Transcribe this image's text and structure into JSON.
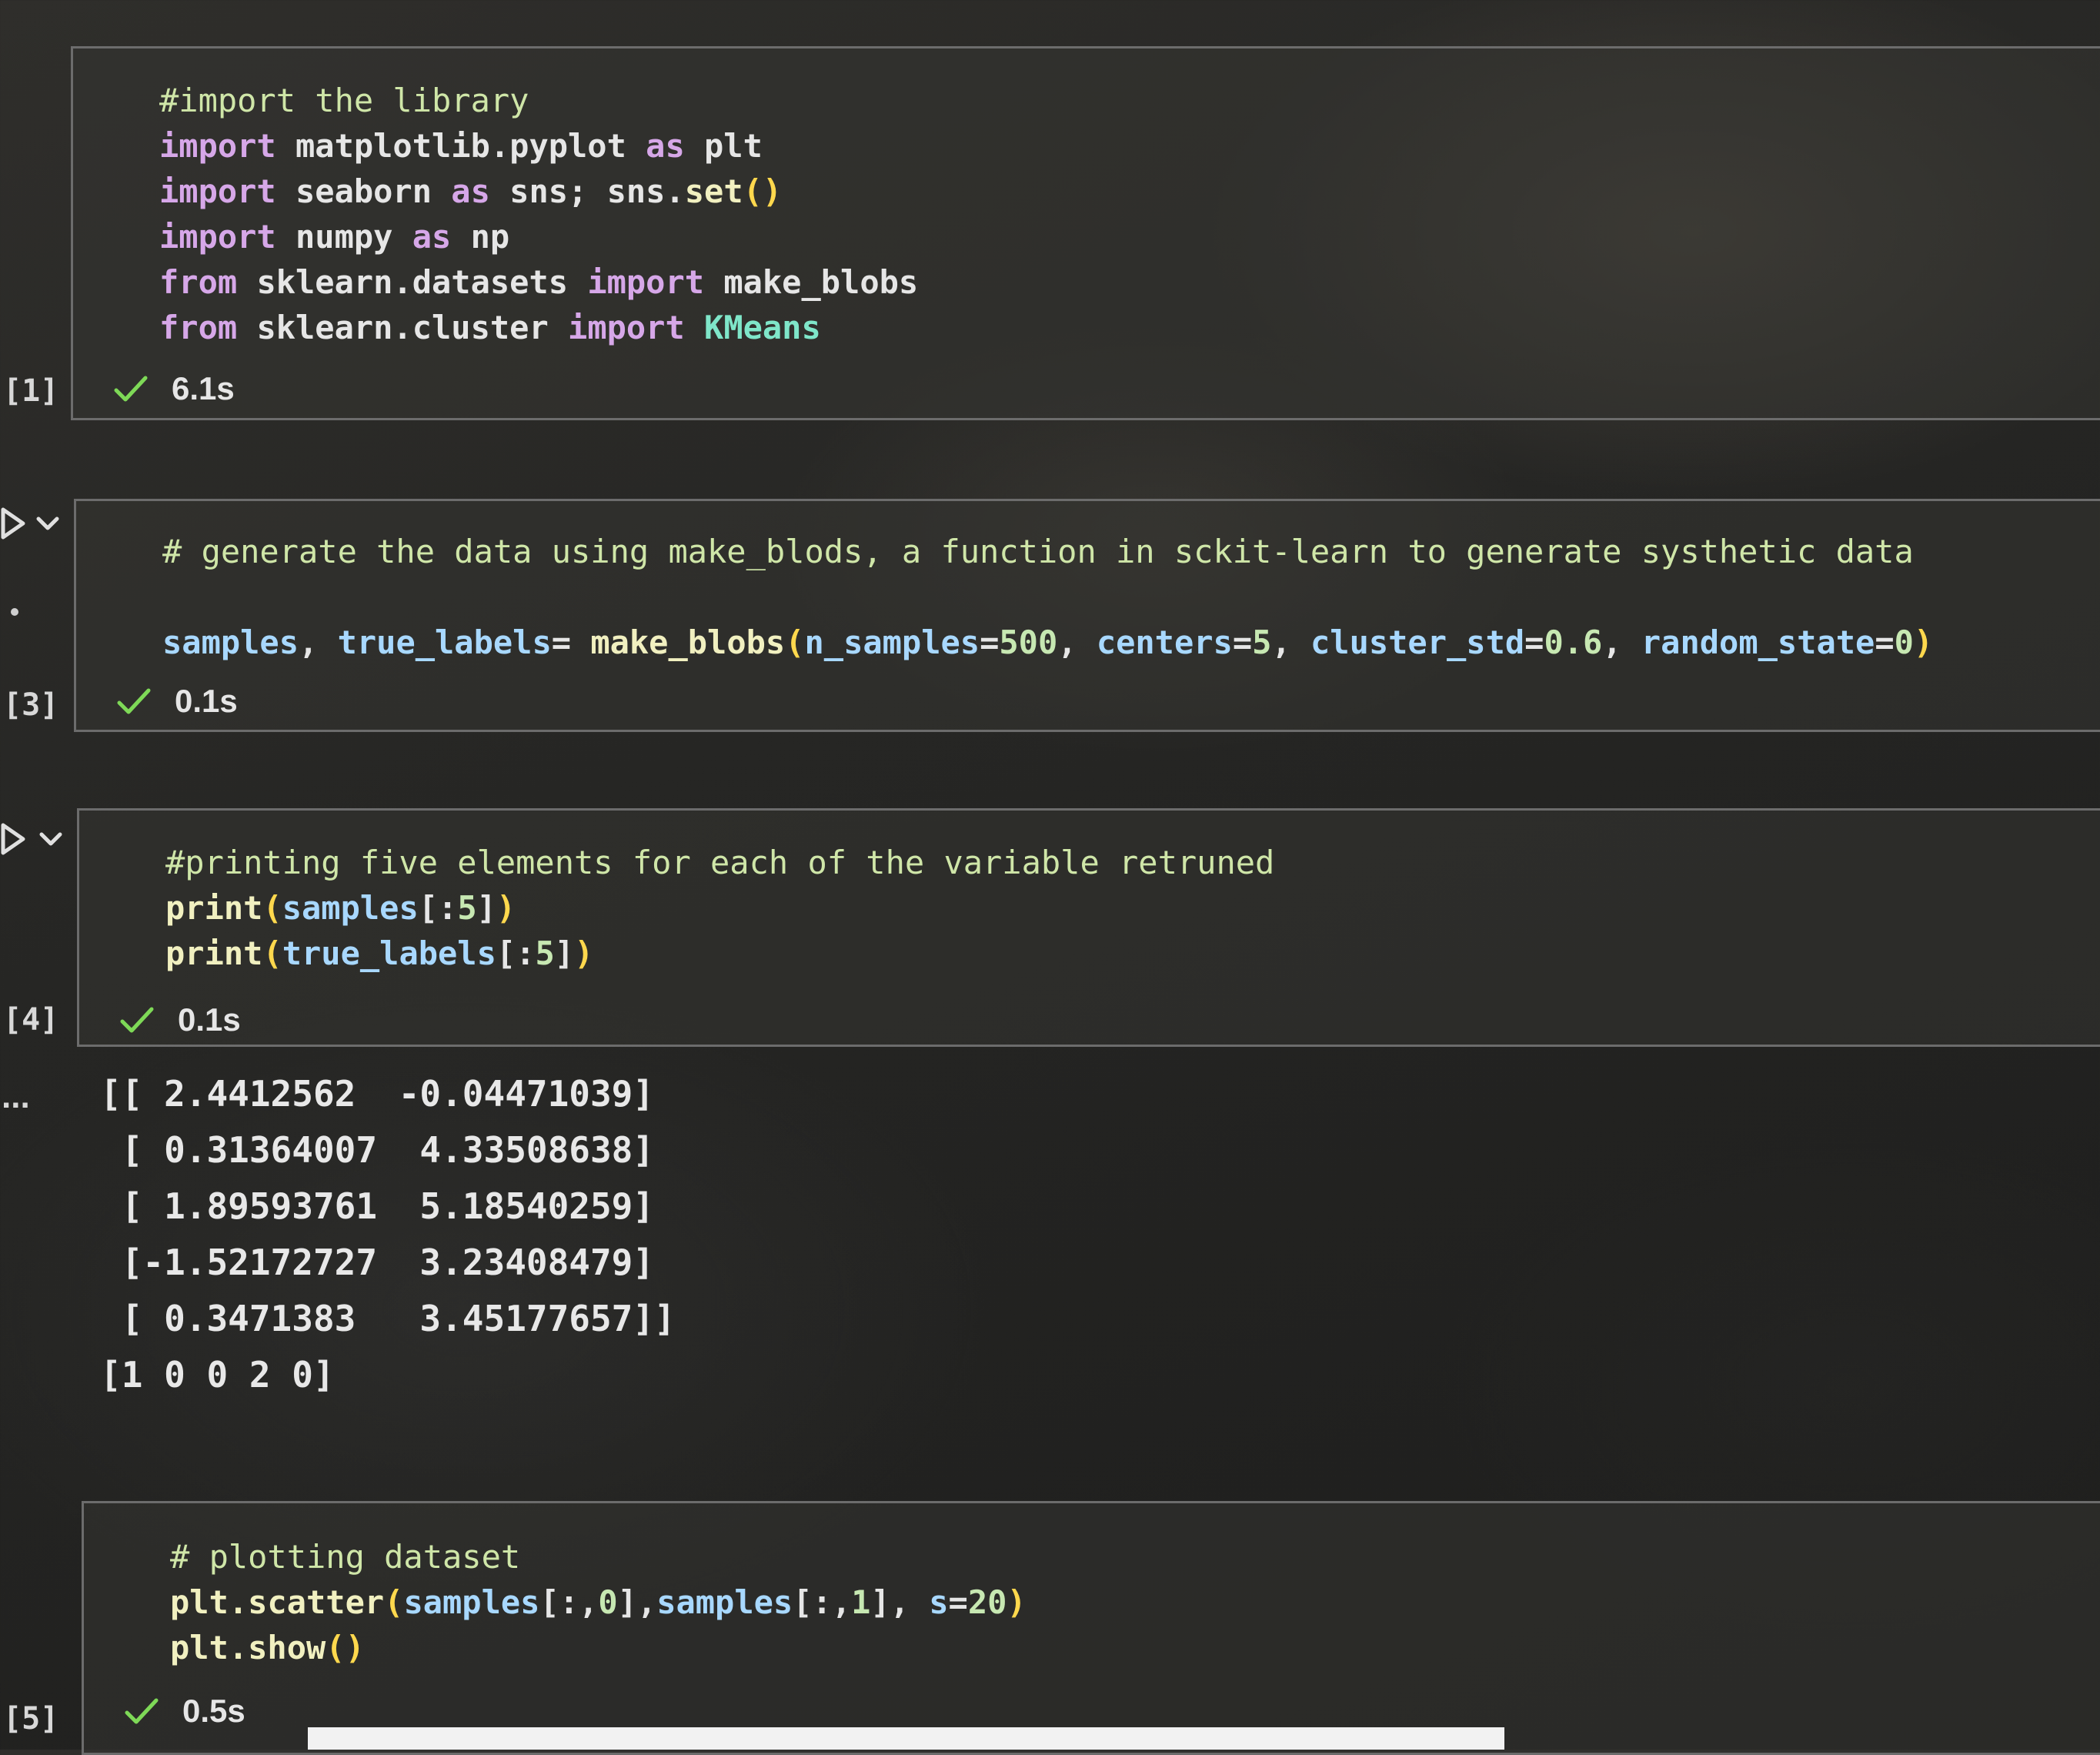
{
  "cells": [
    {
      "exec_count": "[1]",
      "time": "6.1s",
      "lines": [
        [
          {
            "t": "comment",
            "v": "#import the library"
          }
        ],
        [
          {
            "t": "keyword",
            "v": "import"
          },
          {
            "t": "plain",
            "v": " matplotlib.pyplot "
          },
          {
            "t": "keyword",
            "v": "as"
          },
          {
            "t": "plain",
            "v": " plt"
          }
        ],
        [
          {
            "t": "keyword",
            "v": "import"
          },
          {
            "t": "plain",
            "v": " seaborn "
          },
          {
            "t": "keyword",
            "v": "as"
          },
          {
            "t": "plain",
            "v": " sns; sns."
          },
          {
            "t": "fn",
            "v": "set"
          },
          {
            "t": "bracket",
            "v": "()"
          }
        ],
        [
          {
            "t": "keyword",
            "v": "import"
          },
          {
            "t": "plain",
            "v": " numpy "
          },
          {
            "t": "keyword",
            "v": "as"
          },
          {
            "t": "plain",
            "v": " np"
          }
        ],
        [
          {
            "t": "keyword",
            "v": "from"
          },
          {
            "t": "plain",
            "v": " sklearn.datasets "
          },
          {
            "t": "keyword",
            "v": "import"
          },
          {
            "t": "plain",
            "v": " make_blobs"
          }
        ],
        [
          {
            "t": "keyword",
            "v": "from"
          },
          {
            "t": "plain",
            "v": " sklearn.cluster "
          },
          {
            "t": "keyword",
            "v": "import"
          },
          {
            "t": "cls",
            "v": " KMeans"
          }
        ]
      ]
    },
    {
      "exec_count": "[3]",
      "time": "0.1s",
      "lines": [
        [
          {
            "t": "comment",
            "v": "# generate the data using make_blods, a function in sckit-learn to generate systhetic data"
          }
        ],
        [],
        [
          {
            "t": "var",
            "v": "samples"
          },
          {
            "t": "punc",
            "v": ", "
          },
          {
            "t": "var",
            "v": "true_labels"
          },
          {
            "t": "punc",
            "v": "= "
          },
          {
            "t": "fn",
            "v": "make_blobs"
          },
          {
            "t": "bracket",
            "v": "("
          },
          {
            "t": "var",
            "v": "n_samples"
          },
          {
            "t": "punc",
            "v": "="
          },
          {
            "t": "num",
            "v": "500"
          },
          {
            "t": "punc",
            "v": ", "
          },
          {
            "t": "var",
            "v": "centers"
          },
          {
            "t": "punc",
            "v": "="
          },
          {
            "t": "num",
            "v": "5"
          },
          {
            "t": "punc",
            "v": ", "
          },
          {
            "t": "var",
            "v": "cluster_std"
          },
          {
            "t": "punc",
            "v": "="
          },
          {
            "t": "num",
            "v": "0.6"
          },
          {
            "t": "punc",
            "v": ", "
          },
          {
            "t": "var",
            "v": "random_state"
          },
          {
            "t": "punc",
            "v": "="
          },
          {
            "t": "num",
            "v": "0"
          },
          {
            "t": "bracket",
            "v": ")"
          }
        ]
      ]
    },
    {
      "exec_count": "[4]",
      "time": "0.1s",
      "lines": [
        [
          {
            "t": "comment",
            "v": "#printing five elements for each of the variable retruned"
          }
        ],
        [
          {
            "t": "fn",
            "v": "print"
          },
          {
            "t": "bracket",
            "v": "("
          },
          {
            "t": "var",
            "v": "samples"
          },
          {
            "t": "punc",
            "v": "[:"
          },
          {
            "t": "num",
            "v": "5"
          },
          {
            "t": "punc",
            "v": "]"
          },
          {
            "t": "bracket",
            "v": ")"
          }
        ],
        [
          {
            "t": "fn",
            "v": "print"
          },
          {
            "t": "bracket",
            "v": "("
          },
          {
            "t": "var",
            "v": "true_labels"
          },
          {
            "t": "punc",
            "v": "[:"
          },
          {
            "t": "num",
            "v": "5"
          },
          {
            "t": "punc",
            "v": "]"
          },
          {
            "t": "bracket",
            "v": ")"
          }
        ]
      ]
    },
    {
      "exec_count": "[5]",
      "time": "0.5s",
      "lines": [
        [
          {
            "t": "comment",
            "v": "# plotting dataset"
          }
        ],
        [
          {
            "t": "fn",
            "v": "plt.scatter"
          },
          {
            "t": "bracket",
            "v": "("
          },
          {
            "t": "var",
            "v": "samples"
          },
          {
            "t": "punc",
            "v": "[:,"
          },
          {
            "t": "num",
            "v": "0"
          },
          {
            "t": "punc",
            "v": "],"
          },
          {
            "t": "var",
            "v": "samples"
          },
          {
            "t": "punc",
            "v": "[:,"
          },
          {
            "t": "num",
            "v": "1"
          },
          {
            "t": "punc",
            "v": "], "
          },
          {
            "t": "var",
            "v": "s"
          },
          {
            "t": "punc",
            "v": "="
          },
          {
            "t": "num",
            "v": "20"
          },
          {
            "t": "bracket",
            "v": ")"
          }
        ],
        [
          {
            "t": "fn",
            "v": "plt.show"
          },
          {
            "t": "bracket",
            "v": "()"
          }
        ]
      ]
    }
  ],
  "output": {
    "more_marker": "...",
    "lines": [
      "[[ 2.4412562  -0.04471039]",
      " [ 0.31364007  4.33508638]",
      " [ 1.89593761  5.18540259]",
      " [-1.52172727  3.23408479]",
      " [ 0.3471383   3.45177657]]",
      "[1 0 0 2 0]"
    ]
  },
  "colors": {
    "comment": "#cfe6a8",
    "keyword": "#d6a7e8",
    "function": "#f1f0c0",
    "variable": "#a8d8ff",
    "number": "#c7e8b2",
    "bracket": "#ffd84d",
    "class": "#7fe6c9",
    "check": "#7ed957"
  },
  "icons": {
    "run": "play-triangle-icon",
    "collapse": "chevron-down-icon",
    "success": "checkmark-icon"
  }
}
